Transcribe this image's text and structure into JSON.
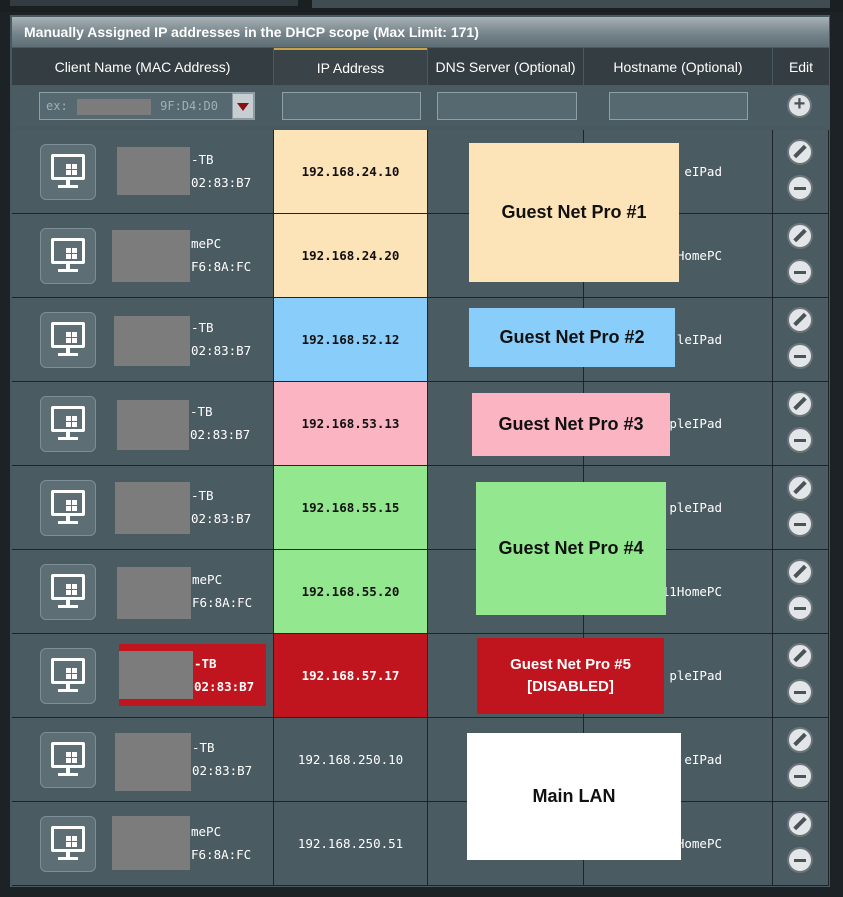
{
  "title": "Manually Assigned IP addresses in the DHCP scope (Max Limit: 171)",
  "columns": [
    "Client Name (MAC Address)",
    "IP Address",
    "DNS Server (Optional)",
    "Hostname (Optional)",
    "Edit"
  ],
  "filter": {
    "mac_placeholder_prefix": "ex:",
    "mac_placeholder_suffix": "9F:D4:D0"
  },
  "rows": [
    {
      "name_tail": "-TB",
      "mac_tail": "02:83:B7",
      "ip": "192.168.24.10",
      "host_tail": "eIPad"
    },
    {
      "name_tail": "mePC",
      "mac_tail": "F6:8A:FC",
      "ip": "192.168.24.20",
      "host_tail": "1HomePC"
    },
    {
      "name_tail": "-TB",
      "mac_tail": "02:83:B7",
      "ip": "192.168.52.12",
      "host_tail": "leIPad"
    },
    {
      "name_tail": "-TB",
      "mac_tail": "02:83:B7",
      "ip": "192.168.53.13",
      "host_tail": "pleIPad"
    },
    {
      "name_tail": "-TB",
      "mac_tail": "02:83:B7",
      "ip": "192.168.55.15",
      "host_tail": "pleIPad"
    },
    {
      "name_tail": "mePC",
      "mac_tail": "F6:8A:FC",
      "ip": "192.168.55.20",
      "host_tail": "11HomePC"
    },
    {
      "name_tail": "-TB",
      "mac_tail": "02:83:B7",
      "ip": "192.168.57.17",
      "host_tail": "pleIPad"
    },
    {
      "name_tail": "-TB",
      "mac_tail": "02:83:B7",
      "ip": "192.168.250.10",
      "host_tail": "eIPad"
    },
    {
      "name_tail": "mePC",
      "mac_tail": "F6:8A:FC",
      "ip": "192.168.250.51",
      "host_tail": "HomePC"
    }
  ],
  "ip_colors": [
    "#fde3b8",
    "#fde3b8",
    "#89cdfa",
    "#fbb4c1",
    "#93e88f",
    "#93e88f",
    "#c0151f",
    "",
    ""
  ],
  "overlays": [
    {
      "label": "Guest Net Pro #1",
      "color": "#fde3b8"
    },
    {
      "label": "Guest Net Pro #2",
      "color": "#89cdfa"
    },
    {
      "label": "Guest Net Pro #3",
      "color": "#fbb4c1"
    },
    {
      "label": "Guest Net Pro #4",
      "color": "#93e88f"
    },
    {
      "label": "Guest Net Pro #5\n[DISABLED]",
      "color": "#c0151f"
    },
    {
      "label": "Main LAN",
      "color": "#ffffff"
    }
  ],
  "icons": [
    "desktop-windows-icon",
    "add-icon",
    "edit-icon",
    "remove-icon",
    "dropdown-arrow-icon"
  ]
}
